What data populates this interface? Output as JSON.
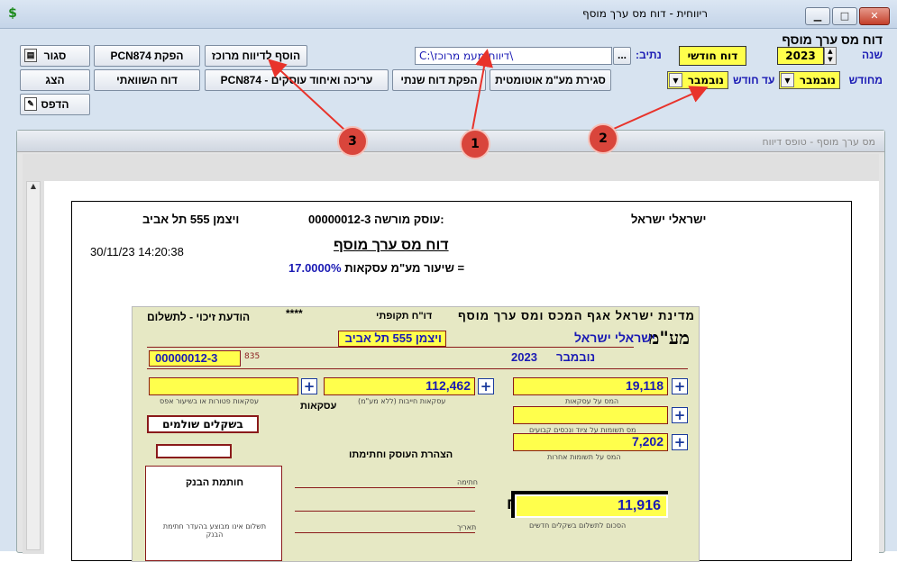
{
  "window": {
    "title": "ריווחית - דוח מס ערך מוסף",
    "app_icon": "$"
  },
  "toolbar": {
    "close": "סגור",
    "pcn874_issue": "הפקת PCN874",
    "add_central": "הוסף לדיווח מרוכז",
    "show": "הצג",
    "comparative": "דוח השוואתי",
    "edit_merge": "עריכה ואיחוד עוסקים - PCN874",
    "annual": "הפקת דוח שנתי",
    "auto_close": "סגירת מע\"מ אוטומטית",
    "print": "הדפס"
  },
  "path": {
    "label": "נתיב:",
    "value": "C:\\דיווח מעמ מרוכז\\",
    "browse": "..."
  },
  "report_type": "דוח חודשי",
  "period": {
    "heading": "דוח מס ערך מוסף",
    "year_label": "שנה",
    "year": "2023",
    "from_label": "מחודש",
    "from_month": "נובמבר",
    "to_label": "עד חודש",
    "to_month": "נובמבר"
  },
  "markers": [
    "1",
    "2",
    "3"
  ],
  "report_panel": {
    "title": "מס ערך מוסף - טופס דיווח"
  },
  "report": {
    "company_left": "ויצמן 555 תל אביב",
    "dealer_label": "עוסק מורשה:",
    "dealer_no": "00000012-3",
    "company_right": "ישראלי ישראל",
    "title": "דוח מס ערך מוסף",
    "datetime": "30/11/23 14:20:38",
    "rate_label": "שיעור מע\"מ עסקאות =",
    "rate": "17.0000%"
  },
  "form": {
    "header_left": "הודעת זיכוי - לתשלום",
    "stars": "****",
    "header_mid": "דו\"ח תקופתי",
    "header_right": "מדינת ישראל אגף המכס ומס ערך מוסף",
    "name": "ישראלי ישראל",
    "address": "ויצמן 555 תל אביב",
    "month": "נובמבר",
    "year": "2023",
    "file_no": "00000012-3",
    "code": "835",
    "taxable_sales": "112,462",
    "vat_on_sales": "19,118",
    "vat_inputs_other": "7,202",
    "total_to_pay": "11,916",
    "currency_box": "בשקלים שולמים",
    "bank_stamp": "חותמת הבנק",
    "bank_note": "תשלום אינו מבוצע בהעדר חתימת הבנק",
    "logo": "מע\"מ",
    "nis": "₪",
    "lbl_sales": "עסקאות חייבות (ללא מע\"מ)",
    "lbl_exempt": "עסקאות פטורות או בשיעור אפס",
    "lbl_vat_sales": "המס על עסקאות",
    "lbl_inputs_fixed": "מס תשומות על ציוד ונכסים קבועים",
    "lbl_inputs_other": "המס על תשומות אחרות",
    "lbl_total": "הסכום לתשלום בשקלים חדשים",
    "declaration": "הצהרת העוסק וחתימתו",
    "lbl_signature": "חתימה",
    "lbl_date": "תאריך",
    "lbl_transactions": "עסקאות"
  }
}
